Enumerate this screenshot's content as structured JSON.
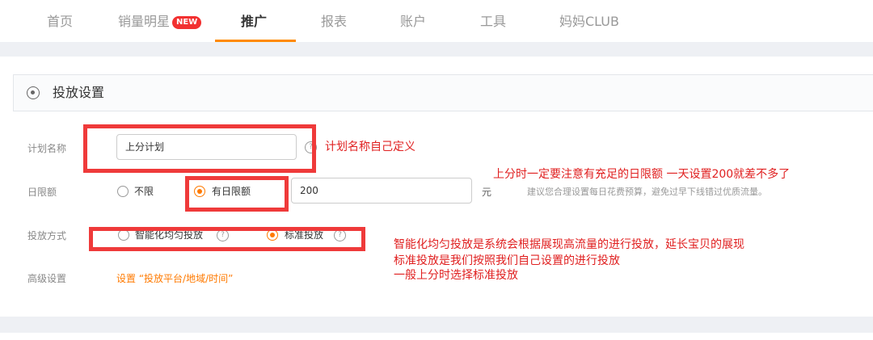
{
  "nav": {
    "items": [
      {
        "label": "首页"
      },
      {
        "label": "销量明星"
      },
      {
        "label": "推广"
      },
      {
        "label": "报表"
      },
      {
        "label": "账户"
      },
      {
        "label": "工具"
      },
      {
        "label": "妈妈CLUB"
      }
    ],
    "badge": "NEW",
    "active_index": 2,
    "accent_color": "#ff8a00"
  },
  "panel": {
    "title": "投放设置",
    "icon": "target-icon"
  },
  "form": {
    "plan_name": {
      "label": "计划名称",
      "value": "上分计划"
    },
    "daily_limit": {
      "label": "日限额",
      "option_unlimited": "不限",
      "option_limited": "有日限额",
      "selected": "有日限额",
      "value": "200",
      "unit": "元",
      "hint": "建议您合理设置每日花费预算，避免过早下线错过优质流量。"
    },
    "delivery": {
      "label": "投放方式",
      "option_smart": "智能化均匀投放",
      "option_standard": "标准投放",
      "selected": "标准投放"
    },
    "advanced": {
      "label": "高级设置",
      "link": "设置 “投放平台/地域/时间”"
    }
  },
  "annotations": {
    "note1": "计划名称自己定义",
    "note2": "上分时一定要注意有充足的日限额 一天设置200就差不多了",
    "note3_line1": "智能化均匀投放是系统会根据展现高流量的进行投放，延长宝贝的展现",
    "note3_line2": "标准投放是我们按照我们自己设置的进行投放",
    "note3_line3": "一般上分时选择标准投放",
    "color": "#e02020"
  }
}
